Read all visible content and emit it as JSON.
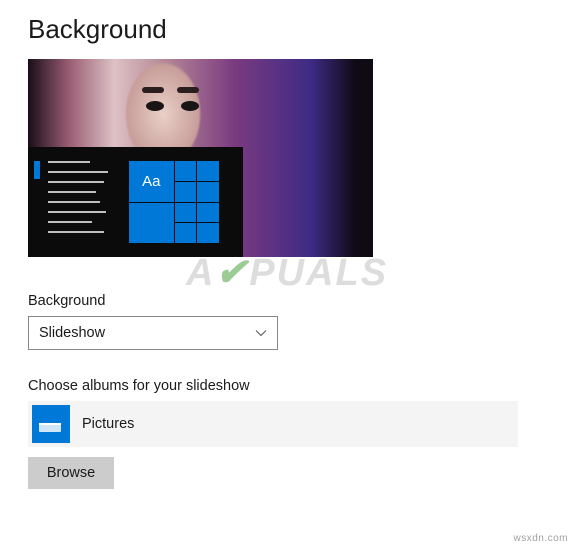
{
  "page": {
    "title": "Background"
  },
  "preview": {
    "tile_text": "Aa"
  },
  "background_section": {
    "label": "Background",
    "dropdown_value": "Slideshow"
  },
  "album_section": {
    "label": "Choose albums for your slideshow",
    "selected_album": "Pictures"
  },
  "buttons": {
    "browse": "Browse"
  },
  "watermark": {
    "prefix": "A",
    "suffix": "PUALS"
  },
  "source": "wsxdn.com"
}
